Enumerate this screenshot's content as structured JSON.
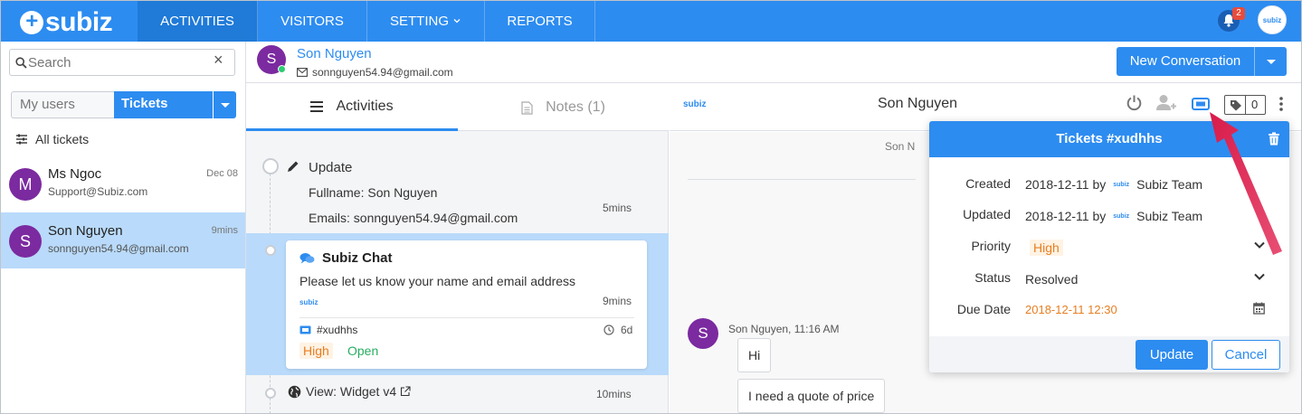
{
  "app": {
    "logo": "subiz"
  },
  "nav": {
    "tabs": [
      {
        "label": "ACTIVITIES"
      },
      {
        "label": "VISITORS"
      },
      {
        "label": "SETTING"
      },
      {
        "label": "REPORTS"
      }
    ],
    "notification_count": "2",
    "avatar_text": "subiz",
    "accent": "#2d8cf0"
  },
  "left": {
    "search_placeholder": "Search",
    "filter_my_users": "My users",
    "filter_tickets": "Tickets",
    "all_tickets": "All tickets",
    "conversations": [
      {
        "initial": "M",
        "name": "Ms Ngoc",
        "sub": "Support@Subiz.com",
        "time": "Dec 08"
      },
      {
        "initial": "S",
        "name": "Son Nguyen",
        "sub": "sonnguyen54.94@gmail.com",
        "time": "9mins"
      }
    ]
  },
  "contact": {
    "initial": "S",
    "name": "Son Nguyen",
    "email": "sonnguyen54.94@gmail.com",
    "new_conversation": "New Conversation"
  },
  "middle": {
    "tab_activities": "Activities",
    "tab_notes": "Notes (1)",
    "update": {
      "title": "Update",
      "fullname": "Fullname: Son Nguyen",
      "emails": "Emails: sonnguyen54.94@gmail.com",
      "time": "5mins"
    },
    "chat": {
      "title": "Subiz Chat",
      "message": "Please let us know your name and email address",
      "logo": "subiz",
      "time": "9mins",
      "ticket_id": "#xudhhs",
      "ticket_age": "6d",
      "priority": "High",
      "status": "Open"
    },
    "view": {
      "title": "View: Widget v4",
      "time": "10mins"
    }
  },
  "right": {
    "logo": "subiz",
    "name": "Son Nguyen",
    "tag_count": "0",
    "system_name": "Son N",
    "message_initial": "S",
    "message_meta": "Son Nguyen, 11:16 AM",
    "bubbles": [
      "Hi",
      "I need a quote of price"
    ]
  },
  "ticket": {
    "title": "Tickets #xudhhs",
    "created_label": "Created",
    "created_value": "2018-12-11 by",
    "created_by": "Subiz Team",
    "updated_label": "Updated",
    "updated_value": "2018-12-11 by",
    "updated_by": "Subiz Team",
    "mini_logo": "subiz",
    "priority_label": "Priority",
    "priority_value": "High",
    "status_label": "Status",
    "status_value": "Resolved",
    "due_label": "Due Date",
    "due_value": "2018-12-11 12:30",
    "update_btn": "Update",
    "cancel_btn": "Cancel"
  }
}
